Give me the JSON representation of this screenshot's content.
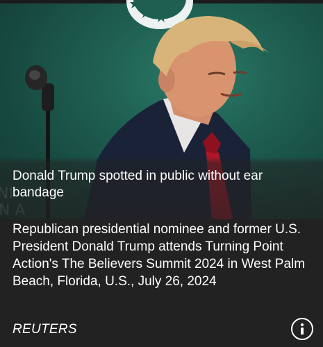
{
  "article": {
    "headline": "Donald Trump spotted in public without ear bandage",
    "caption": "Republican presidential nominee and former U.S. President Donald Trump attends Turning Point Action's The Believers Summit 2024 in West Palm Beach, Florida, U.S., July 26, 2024",
    "source": "REUTERS"
  },
  "photo": {
    "background_color": "#1f5f52",
    "suit_color": "#1a2238",
    "tie_color": "#b0172a"
  },
  "icons": {
    "info": "info-icon"
  }
}
